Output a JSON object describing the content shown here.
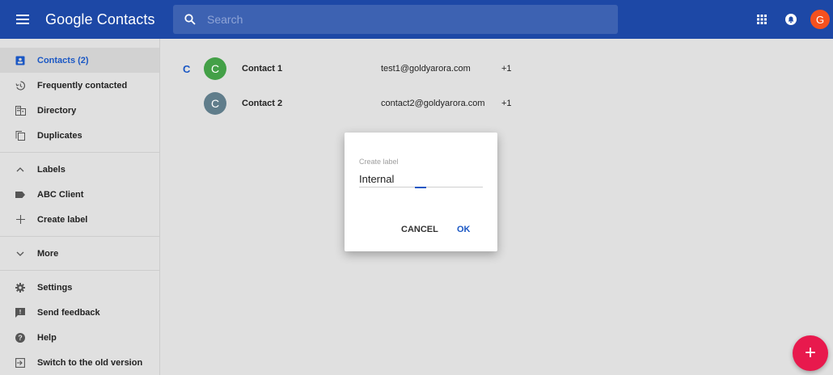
{
  "header": {
    "title": "Google Contacts",
    "search_placeholder": "Search",
    "avatar_letter": "G",
    "brand_color": "#1d48a6",
    "avatar_color": "#f4511e"
  },
  "sidebar": {
    "items": [
      {
        "label": "Contacts (2)",
        "icon": "contacts-icon"
      },
      {
        "label": "Frequently contacted",
        "icon": "history-icon"
      },
      {
        "label": "Directory",
        "icon": "domain-icon"
      },
      {
        "label": "Duplicates",
        "icon": "copy-icon"
      },
      {
        "label": "Labels",
        "icon": "chevron-up-icon"
      },
      {
        "label": "ABC Client",
        "icon": "label-icon"
      },
      {
        "label": "Create label",
        "icon": "plus-icon"
      },
      {
        "label": "More",
        "icon": "chevron-down-icon"
      },
      {
        "label": "Settings",
        "icon": "gear-icon"
      },
      {
        "label": "Send feedback",
        "icon": "feedback-icon"
      },
      {
        "label": "Help",
        "icon": "help-icon"
      },
      {
        "label": "Switch to the old version",
        "icon": "exit-icon"
      }
    ]
  },
  "contacts": {
    "section_letter": "C",
    "rows": [
      {
        "initial": "C",
        "name": "Contact 1",
        "email": "test1@goldyarora.com",
        "phone": "+1",
        "color": "#43a047"
      },
      {
        "initial": "C",
        "name": "Contact 2",
        "email": "contact2@goldyarora.com",
        "phone": "+1",
        "color": "#607d8b"
      }
    ]
  },
  "dialog": {
    "label": "Create label",
    "value": "Internal",
    "cancel": "CANCEL",
    "ok": "OK"
  },
  "fab": {
    "label": "+",
    "color": "#e8194d"
  }
}
